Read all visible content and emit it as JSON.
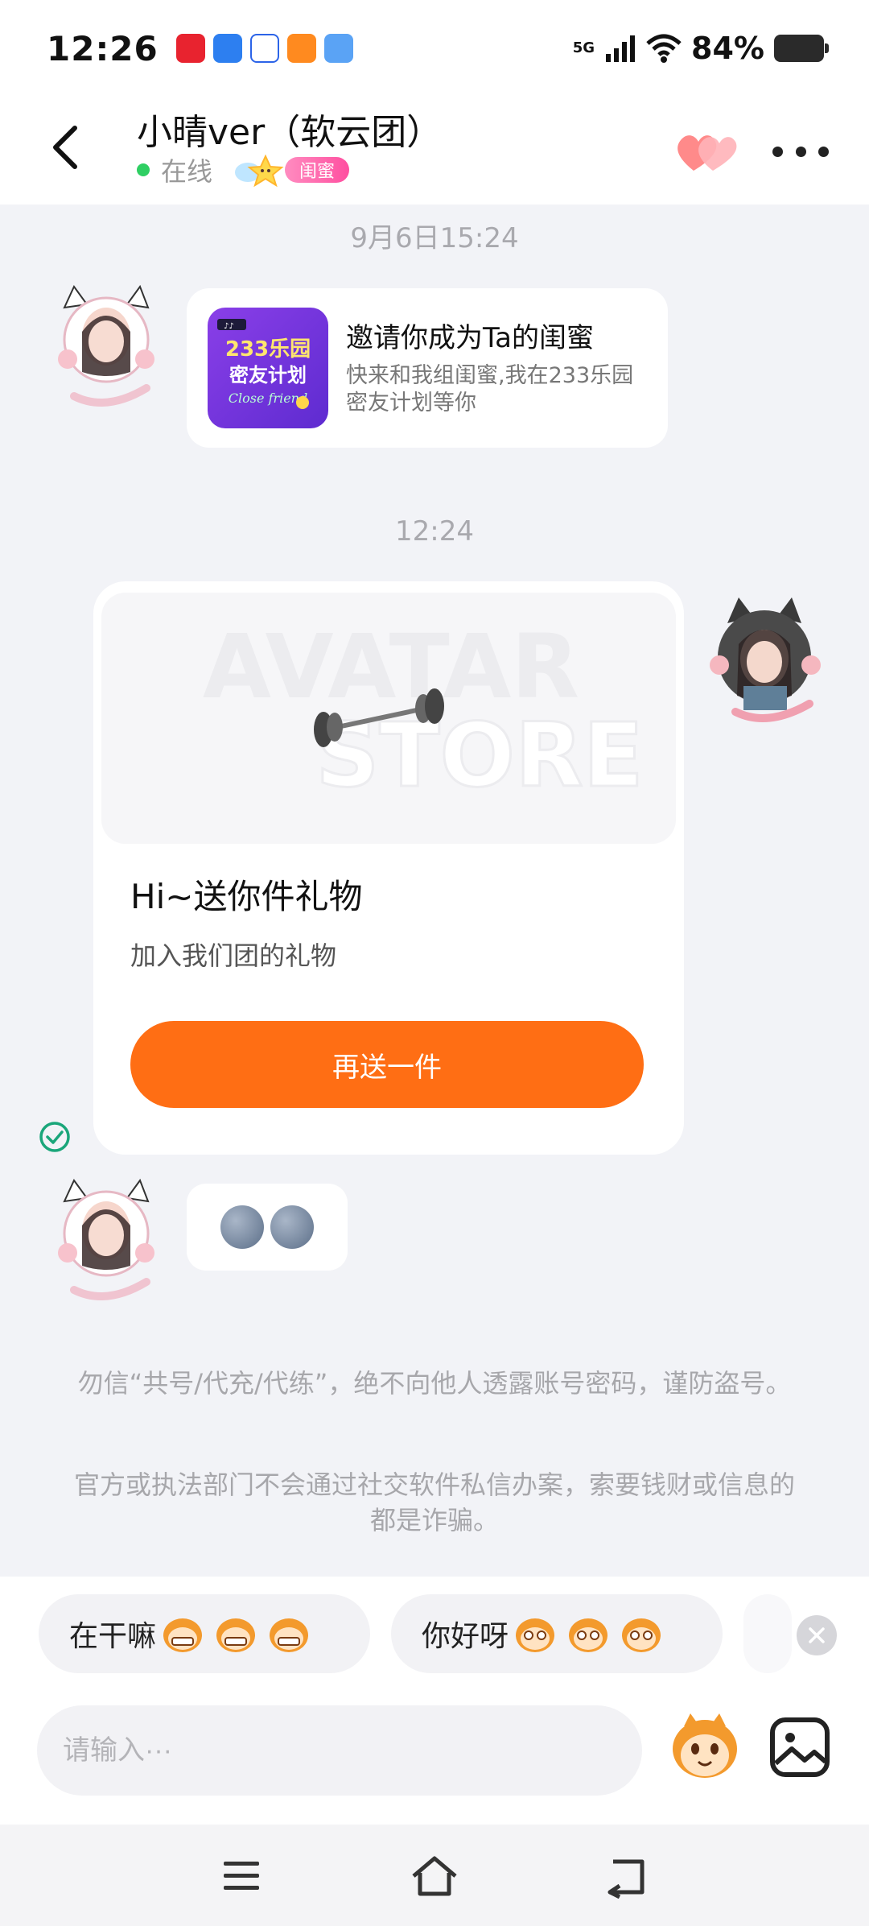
{
  "status_bar": {
    "time": "12:26",
    "network": "5G",
    "battery": "84%"
  },
  "header": {
    "title": "小晴ver（软云团）",
    "status": "在线",
    "badge": "闺蜜"
  },
  "chat": {
    "timestamp_1": "9月6日15:24",
    "invite_card": {
      "title": "邀请你成为Ta的闺蜜",
      "description": "快来和我组闺蜜,我在233乐园密友计划等你",
      "image_text_1": "233乐园",
      "image_text_2": "密友计划",
      "image_text_3": "Close friend"
    },
    "timestamp_2": "12:24",
    "gift_card": {
      "banner_watermark_1": "AVATAR",
      "banner_watermark_2": "STORE",
      "title": "Hi~送你件礼物",
      "subtitle": "加入我们团的礼物",
      "button": "再送一件"
    },
    "emoji_message": "moon-face emoji ×2"
  },
  "notices": {
    "line_1": "勿信“共号/代充/代练”，绝不向他人透露账号密码，谨防盗号。",
    "line_2": "官方或执法部门不会通过社交软件私信办案，索要钱财或信息的都是诈骗。"
  },
  "quick_replies": [
    {
      "label": "在干嘛"
    },
    {
      "label": "你好呀"
    }
  ],
  "input": {
    "placeholder": "请输入···"
  },
  "colors": {
    "accent": "#ff6e14",
    "online": "#2fcf63",
    "badge": "#ff4fa0",
    "invite_bg": "#7a35e0"
  }
}
